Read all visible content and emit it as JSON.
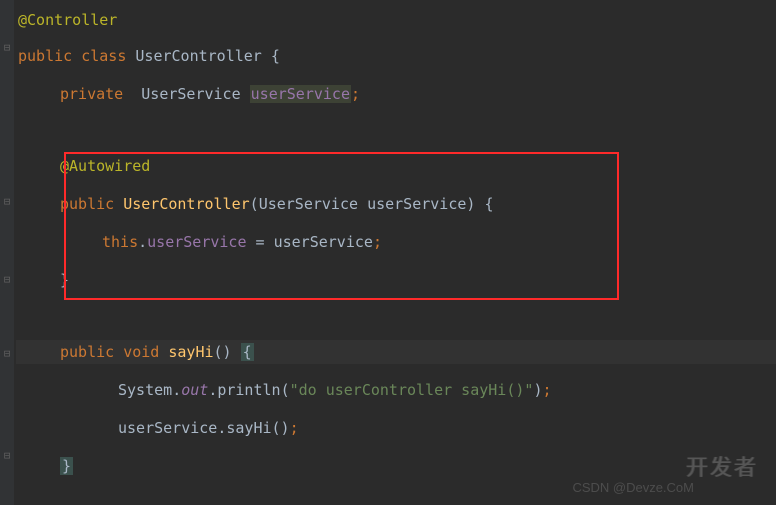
{
  "code": {
    "annotation_controller": "@Controller",
    "kw_public": "public",
    "kw_class": "class",
    "class_name": "UserController",
    "open_brace": "{",
    "kw_private": "private",
    "type_userservice": "UserService",
    "field_userservice": "userService",
    "semicolon": ";",
    "annotation_autowired": "@Autowired",
    "ctor_name": "UserController",
    "param_type": "UserService",
    "param_name": "userService",
    "close_paren_brace": ") {",
    "kw_this": "this",
    "dot": ".",
    "assign": " = ",
    "close_brace": "}",
    "kw_void": "void",
    "method_sayhi": "sayHi",
    "parens": "()",
    "sys": "System",
    "out": "out",
    "println": "println",
    "string_lit": "\"do userController sayHi()\"",
    "close_paren_semi": ");"
  },
  "watermark": {
    "main": "开发者",
    "sub": "CSDN @Devze.CoM"
  }
}
